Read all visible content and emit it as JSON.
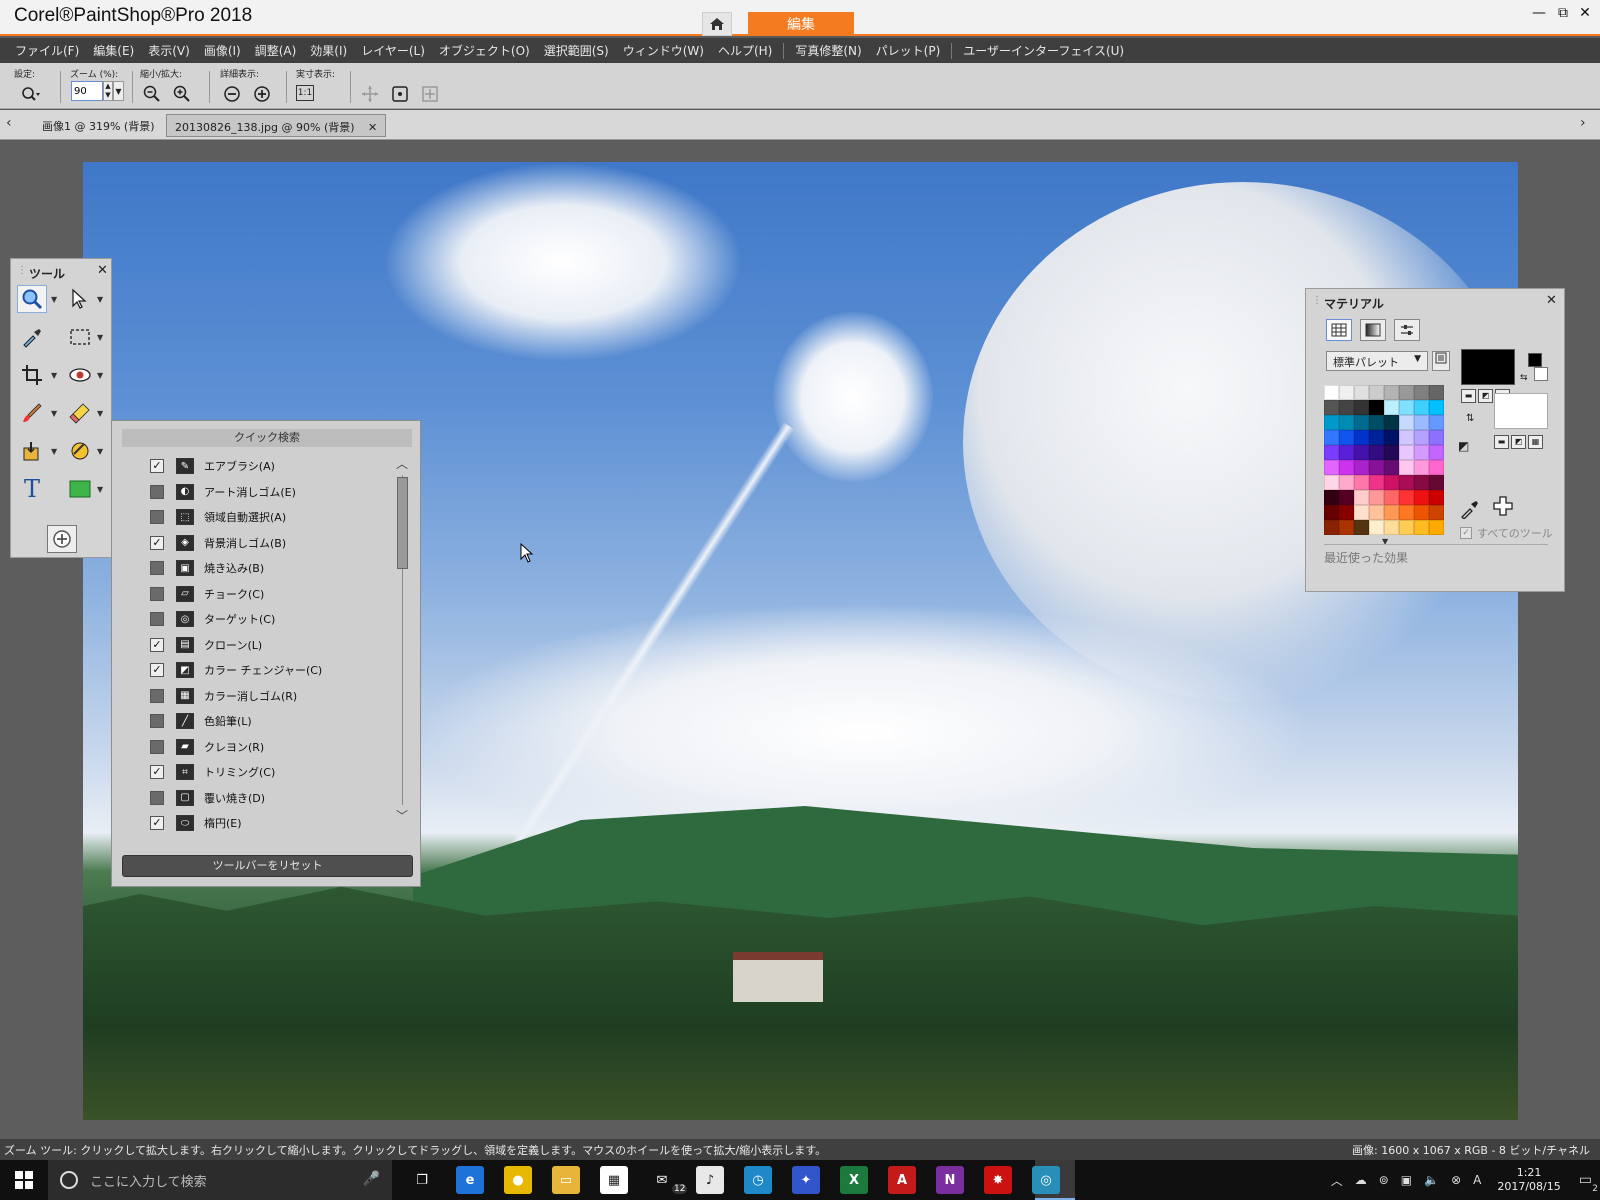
{
  "window": {
    "title": "Corel®PaintShop®Pro 2018",
    "workspace_tab": "編集",
    "controls": [
      "—",
      "⧉",
      "✕"
    ]
  },
  "menu": {
    "items": [
      "ファイル(F)",
      "編集(E)",
      "表示(V)",
      "画像(I)",
      "調整(A)",
      "効果(I)",
      "レイヤー(L)",
      "オブジェクト(O)",
      "選択範囲(S)",
      "ウィンドウ(W)",
      "ヘルプ(H)"
    ],
    "items2": [
      "写真修整(N)",
      "パレット(P)"
    ],
    "items3": [
      "ユーザーインターフェイス(U)"
    ]
  },
  "options": {
    "preset_label": "設定:",
    "zoom_label": "ズーム (%):",
    "zoom_value": "90",
    "zoom_in_out_label": "縮小/拡大:",
    "detail_label": "詳細表示:",
    "actual_size_label": "実寸表示:",
    "actual_size_icon": "1:1"
  },
  "tabs": {
    "items": [
      "画像1 @ 319% (背景)",
      "20130826_138.jpg @  90% (背景)"
    ],
    "close": "✕"
  },
  "tools_panel": {
    "title": "ツール",
    "close": "✕",
    "text_tool": "T"
  },
  "quick_search": {
    "title": "クイック検索",
    "items": [
      {
        "label": "エアブラシ(A)",
        "checked": true
      },
      {
        "label": "アート消しゴム(E)",
        "checked": false
      },
      {
        "label": "領域自動選択(A)",
        "checked": false
      },
      {
        "label": "背景消しゴム(B)",
        "checked": true
      },
      {
        "label": "焼き込み(B)",
        "checked": false
      },
      {
        "label": "チョーク(C)",
        "checked": false
      },
      {
        "label": "ターゲット(C)",
        "checked": false
      },
      {
        "label": "クローン(L)",
        "checked": true
      },
      {
        "label": "カラー チェンジャー(C)",
        "checked": true
      },
      {
        "label": "カラー消しゴム(R)",
        "checked": false
      },
      {
        "label": "色鉛筆(L)",
        "checked": false
      },
      {
        "label": "クレヨン(R)",
        "checked": false
      },
      {
        "label": "トリミング(C)",
        "checked": true
      },
      {
        "label": "覆い焼き(D)",
        "checked": false
      },
      {
        "label": "楕円(E)",
        "checked": true
      }
    ],
    "reset_button": "ツールバーをリセット"
  },
  "materials": {
    "title": "マテリアル",
    "close": "✕",
    "palette_select": "標準パレット",
    "all_tools": "すべてのツール",
    "recent_effects": "最近使った効果",
    "foreground_color": "#000000",
    "background_color": "#ffffff",
    "swatches": [
      "#ffffff",
      "#f0f0f0",
      "#e0e0e0",
      "#cccccc",
      "#b3b3b3",
      "#999999",
      "#808080",
      "#666666",
      "#555555",
      "#444444",
      "#333333",
      "#000000",
      "#bdf0ff",
      "#80e0ff",
      "#40d0ff",
      "#00c0ff",
      "#0099cc",
      "#008bb3",
      "#006b8f",
      "#004d66",
      "#003344",
      "#c6d9ff",
      "#99bbff",
      "#6699ff",
      "#3377ff",
      "#1155ee",
      "#0033cc",
      "#002299",
      "#001166",
      "#d1c6ff",
      "#b3a0ff",
      "#8c70ff",
      "#7a3dff",
      "#5a1fd9",
      "#4411aa",
      "#330d80",
      "#220855",
      "#e8c6ff",
      "#d699ff",
      "#c266ff",
      "#e066ff",
      "#cc33ee",
      "#aa22cc",
      "#881199",
      "#660d73",
      "#ffc6f0",
      "#ff99dd",
      "#ff66cc",
      "#ffd6e8",
      "#ffaacc",
      "#ff77aa",
      "#ee3388",
      "#cc1166",
      "#aa0d55",
      "#880a44",
      "#660833",
      "#330011",
      "#550022",
      "#ffcccc",
      "#ff9999",
      "#ff6666",
      "#ff3333",
      "#ee1111",
      "#cc0000",
      "#660000",
      "#880000",
      "#ffe0cc",
      "#ffc299",
      "#ff9955",
      "#ff7722",
      "#ee5500",
      "#cc4400",
      "#882200",
      "#aa3300",
      "#553311",
      "#ffeecc",
      "#ffdd99",
      "#ffcc55",
      "#ffbb22",
      "#ffaa00"
    ]
  },
  "status": {
    "left": "ズーム ツール: クリックして拡大します。右クリックして縮小します。クリックしてドラッグし、領域を定義します。マウスのホイールを使って拡大/縮小表示します。",
    "right": "画像:  1600 x 1067 x RGB - 8 ビット/チャネル"
  },
  "taskbar": {
    "search_placeholder": "ここに入力して検索",
    "mail_badge": "12",
    "time": "1:21",
    "date": "2017/08/15",
    "ime": "A",
    "notifications": "2",
    "apps": [
      {
        "name": "task-view",
        "label": "❐",
        "color": "#101010"
      },
      {
        "name": "edge",
        "label": "e",
        "color": "#1e73d8"
      },
      {
        "name": "chrome",
        "label": "●",
        "color": "#e6b800"
      },
      {
        "name": "file-explorer",
        "label": "▭",
        "color": "#e8b53a"
      },
      {
        "name": "store",
        "label": "▦",
        "color": "#ffffff"
      },
      {
        "name": "mail",
        "label": "✉",
        "color": "#101010"
      },
      {
        "name": "itunes",
        "label": "♪",
        "color": "#e8e8e8"
      },
      {
        "name": "app-blue",
        "label": "◷",
        "color": "#1e88c8"
      },
      {
        "name": "app-color",
        "label": "✦",
        "color": "#3355cc"
      },
      {
        "name": "excel",
        "label": "X",
        "color": "#1d7a3e"
      },
      {
        "name": "acrobat",
        "label": "A",
        "color": "#c41a1a"
      },
      {
        "name": "onenote",
        "label": "N",
        "color": "#7b2ea0"
      },
      {
        "name": "app-red",
        "label": "✸",
        "color": "#cc1111"
      },
      {
        "name": "paintshop",
        "label": "◎",
        "color": "#2a8fb8"
      }
    ]
  }
}
